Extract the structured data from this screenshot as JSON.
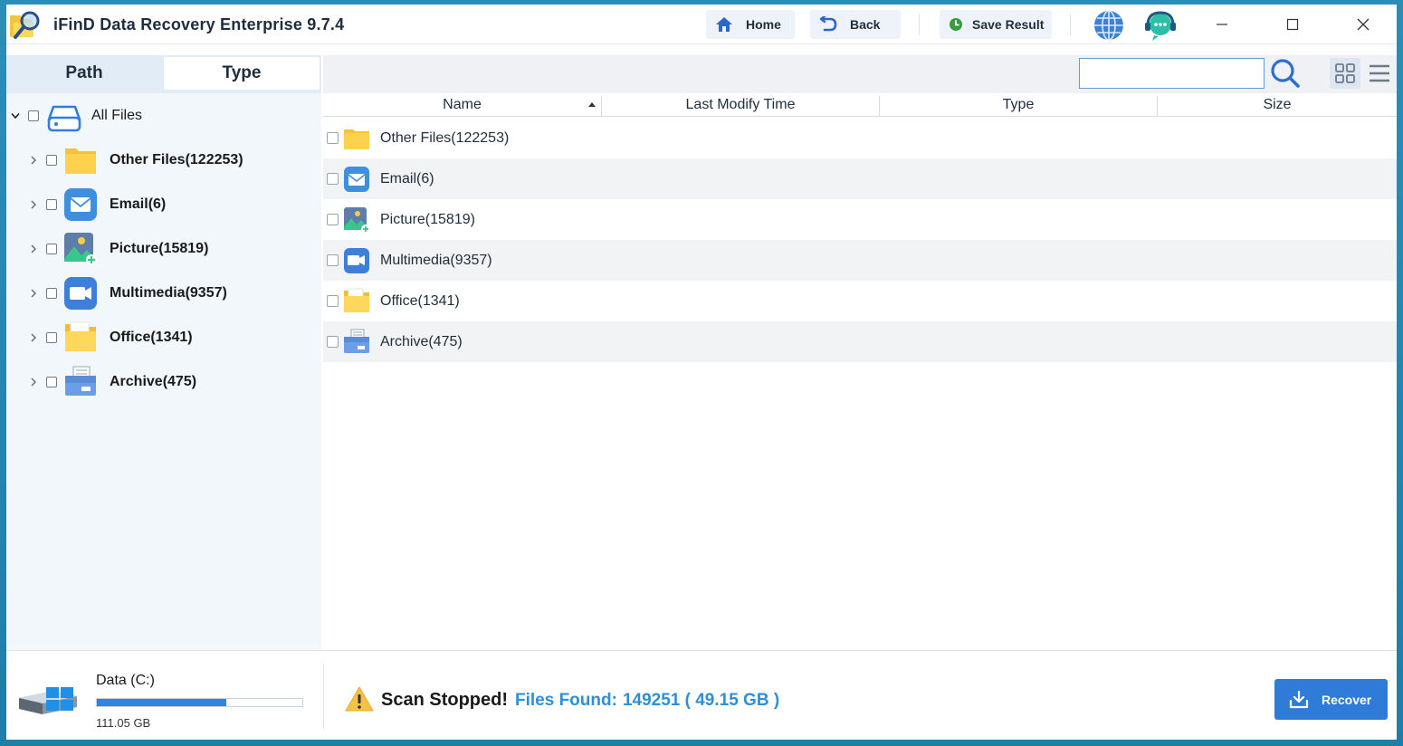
{
  "app": {
    "title": "iFinD Data Recovery Enterprise 9.7.4"
  },
  "titlebar": {
    "home_label": "Home",
    "back_label": "Back",
    "save_label": "Save Result"
  },
  "left_panel": {
    "tabs": [
      {
        "label": "Path",
        "active": false
      },
      {
        "label": "Type",
        "active": true
      }
    ],
    "tree": {
      "root": {
        "label": "All Files",
        "icon": "drive-icon",
        "expanded": true
      },
      "items": [
        {
          "label": "Other Files(122253)",
          "icon": "folder-icon"
        },
        {
          "label": "Email(6)",
          "icon": "email-icon"
        },
        {
          "label": "Picture(15819)",
          "icon": "picture-icon"
        },
        {
          "label": "Multimedia(9357)",
          "icon": "multimedia-icon"
        },
        {
          "label": "Office(1341)",
          "icon": "office-icon"
        },
        {
          "label": "Archive(475)",
          "icon": "archive-icon"
        }
      ]
    }
  },
  "search": {
    "value": "",
    "placeholder": ""
  },
  "table": {
    "columns": [
      "Name",
      "Last Modify Time",
      "Type",
      "Size"
    ],
    "sort_column": "Name",
    "rows": [
      {
        "name": "Other Files(122253)",
        "icon": "folder-icon"
      },
      {
        "name": "Email(6)",
        "icon": "email-icon"
      },
      {
        "name": "Picture(15819)",
        "icon": "picture-icon"
      },
      {
        "name": "Multimedia(9357)",
        "icon": "multimedia-icon"
      },
      {
        "name": "Office(1341)",
        "icon": "office-icon"
      },
      {
        "name": "Archive(475)",
        "icon": "archive-icon"
      }
    ]
  },
  "footer": {
    "drive_name": "Data (C:)",
    "drive_size": "111.05 GB",
    "drive_used_fraction": 0.63,
    "scan_status": "Scan Stopped!",
    "files_found_label": "Files Found:",
    "files_found_value": "149251 ( 49.15 GB )",
    "recover_label": "Recover"
  },
  "colors": {
    "accent": "#2e7bd8",
    "link_blue": "#2e8fd6",
    "panel_bg": "#f2f7fc",
    "desktop_bg": "#1d7fa8"
  }
}
